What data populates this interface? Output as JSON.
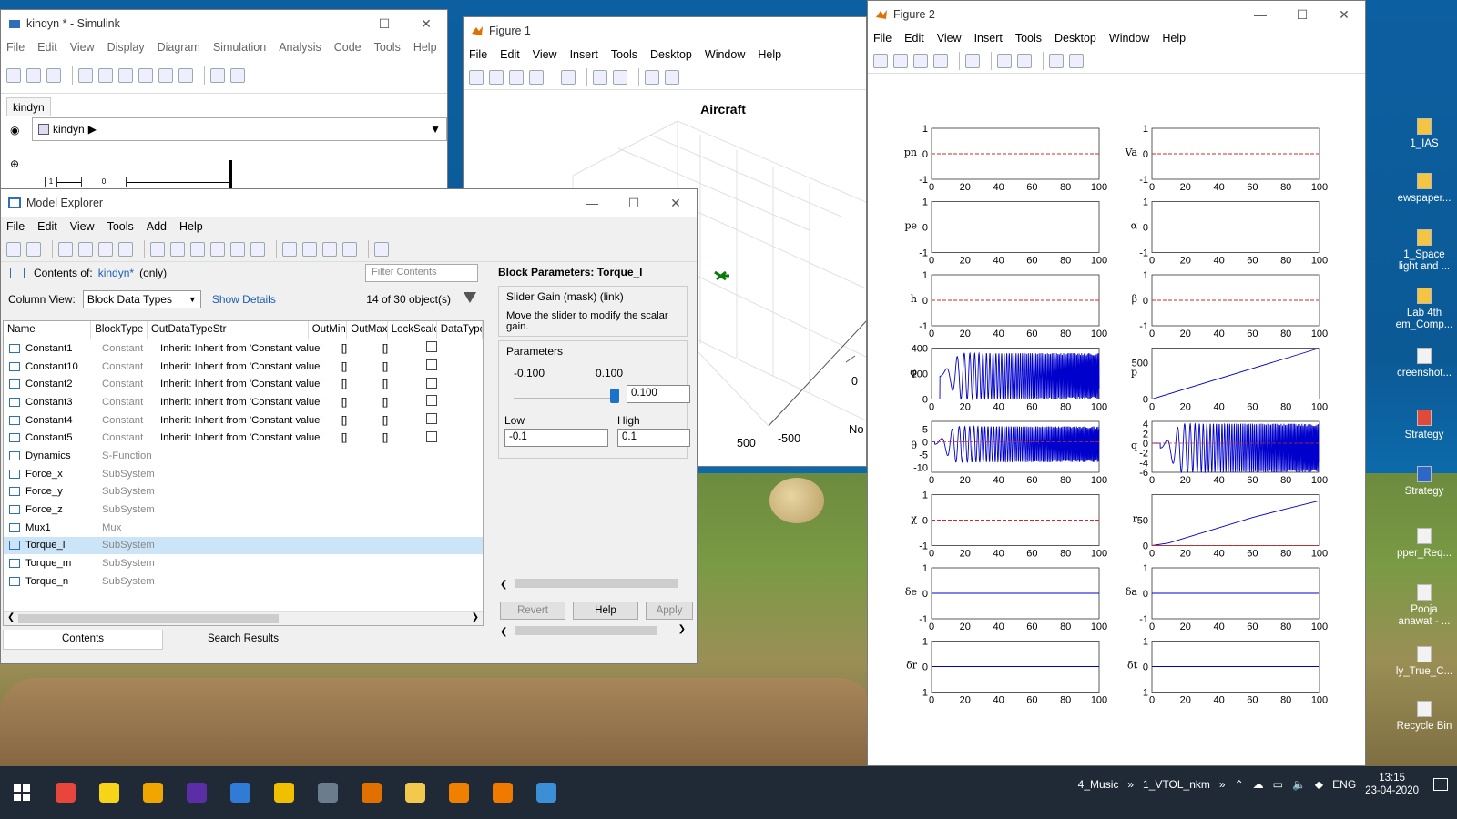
{
  "desktop": {
    "icons": [
      {
        "label": "1_IAS",
        "color": "y"
      },
      {
        "label": "ewspaper...",
        "color": "y"
      },
      {
        "label": "1_Space\nlight and ...",
        "color": "y"
      },
      {
        "label": "Lab 4th\nem_Comp...",
        "color": "y"
      },
      {
        "label": "creenshot...",
        "color": "w"
      },
      {
        "label": "Strategy",
        "color": "r"
      },
      {
        "label": "Strategy",
        "color": "b"
      },
      {
        "label": "pper_Req...",
        "color": "w"
      },
      {
        "label": "Pooja\nanawat - ...",
        "color": "o"
      },
      {
        "label": "ly_True_C...",
        "color": "w"
      },
      {
        "label": "Recycle Bin",
        "color": "w"
      }
    ]
  },
  "simulink": {
    "title": "kindyn * - Simulink",
    "menu": [
      "File",
      "Edit",
      "View",
      "Display",
      "Diagram",
      "Simulation",
      "Analysis",
      "Code",
      "Tools",
      "Help"
    ],
    "tab": "kindyn",
    "address": "kindyn",
    "block_labels": [
      "1",
      "0"
    ]
  },
  "figure1": {
    "title": "Figure 1",
    "menu": [
      "File",
      "Edit",
      "View",
      "Insert",
      "Tools",
      "Desktop",
      "Window",
      "Help"
    ],
    "plot_title": "Aircraft",
    "tick_labels": [
      "0",
      "500",
      "-500"
    ],
    "axis_label_partial": "No"
  },
  "figure2": {
    "title": "Figure 2",
    "menu": [
      "File",
      "Edit",
      "View",
      "Insert",
      "Tools",
      "Desktop",
      "Window",
      "Help"
    ],
    "x_ticks": [
      "0",
      "20",
      "40",
      "60",
      "80",
      "100"
    ]
  },
  "chart_data": [
    {
      "type": "line",
      "ylabel": "pn",
      "xlim": [
        0,
        100
      ],
      "ylim": [
        -1,
        1
      ],
      "yticks": [
        "1",
        "0",
        "-1"
      ],
      "series": [
        {
          "values": [
            [
              0,
              0
            ],
            [
              100,
              0
            ]
          ],
          "color": "#d62728",
          "dashed": true
        }
      ]
    },
    {
      "type": "line",
      "ylabel": "Va",
      "xlim": [
        0,
        100
      ],
      "ylim": [
        -1,
        1
      ],
      "yticks": [
        "1",
        "0",
        "-1"
      ],
      "series": [
        {
          "values": [
            [
              0,
              0
            ],
            [
              100,
              0
            ]
          ],
          "color": "#d62728",
          "dashed": true
        }
      ]
    },
    {
      "type": "line",
      "ylabel": "pe",
      "xlim": [
        0,
        100
      ],
      "ylim": [
        -1,
        1
      ],
      "yticks": [
        "1",
        "0",
        "-1"
      ],
      "series": [
        {
          "values": [
            [
              0,
              0
            ],
            [
              100,
              0
            ]
          ],
          "color": "#d62728",
          "dashed": true
        }
      ]
    },
    {
      "type": "line",
      "ylabel": "α",
      "xlim": [
        0,
        100
      ],
      "ylim": [
        -1,
        1
      ],
      "yticks": [
        "1",
        "0",
        "-1"
      ],
      "series": [
        {
          "values": [
            [
              0,
              0
            ],
            [
              100,
              0
            ]
          ],
          "color": "#d62728",
          "dashed": true
        }
      ]
    },
    {
      "type": "line",
      "ylabel": "h",
      "xlim": [
        0,
        100
      ],
      "ylim": [
        -1,
        1
      ],
      "yticks": [
        "1",
        "0",
        "-1"
      ],
      "series": [
        {
          "values": [
            [
              0,
              0
            ],
            [
              100,
              0
            ]
          ],
          "color": "#d62728",
          "dashed": true
        }
      ]
    },
    {
      "type": "line",
      "ylabel": "β",
      "xlim": [
        0,
        100
      ],
      "ylim": [
        -1,
        1
      ],
      "yticks": [
        "1",
        "0",
        "-1"
      ],
      "series": [
        {
          "values": [
            [
              0,
              0
            ],
            [
              100,
              0
            ]
          ],
          "color": "#d62728",
          "dashed": true
        }
      ]
    },
    {
      "type": "line",
      "ylabel": "φ",
      "xlim": [
        0,
        100
      ],
      "ylim": [
        0,
        400
      ],
      "yticks": [
        "400",
        "200",
        "0"
      ],
      "series": [
        {
          "kind": "oscillation",
          "amplitude": [
            0,
            360
          ],
          "start": 5,
          "color": "#0000cc"
        }
      ]
    },
    {
      "type": "line",
      "ylabel": "p",
      "xlim": [
        0,
        100
      ],
      "ylim": [
        0,
        700
      ],
      "yticks": [
        "500",
        "0"
      ],
      "series": [
        {
          "values": [
            [
              0,
              0
            ],
            [
              100,
              700
            ]
          ],
          "color": "#0000cc"
        },
        {
          "values": [
            [
              0,
              0
            ],
            [
              100,
              0
            ]
          ],
          "color": "#d62728",
          "dashed": true
        }
      ]
    },
    {
      "type": "line",
      "ylabel": "θ",
      "xlim": [
        0,
        100
      ],
      "ylim": [
        -12,
        8
      ],
      "yticks": [
        "5",
        "0",
        "-5",
        "-10"
      ],
      "series": [
        {
          "kind": "oscillation",
          "amplitude": [
            -8,
            6
          ],
          "start": 2,
          "color": "#0000cc"
        }
      ]
    },
    {
      "type": "line",
      "ylabel": "q",
      "xlim": [
        0,
        100
      ],
      "ylim": [
        -6,
        4.5
      ],
      "yticks": [
        "4",
        "2",
        "0",
        "-2",
        "-4",
        "-6"
      ],
      "series": [
        {
          "kind": "oscillation",
          "amplitude": [
            -6,
            4
          ],
          "start": 5,
          "color": "#0000cc"
        }
      ]
    },
    {
      "type": "line",
      "ylabel": "χ",
      "xlim": [
        0,
        100
      ],
      "ylim": [
        -1,
        1
      ],
      "yticks": [
        "1",
        "0",
        "-1"
      ],
      "series": [
        {
          "values": [
            [
              0,
              0
            ],
            [
              100,
              0
            ]
          ],
          "color": "#d62728",
          "dashed": true
        }
      ]
    },
    {
      "type": "line",
      "ylabel": "r",
      "xlim": [
        0,
        100
      ],
      "ylim": [
        0,
        100
      ],
      "yticks": [
        "50",
        "0"
      ],
      "series": [
        {
          "values": [
            [
              0,
              0
            ],
            [
              10,
              5
            ],
            [
              20,
              15
            ],
            [
              40,
              35
            ],
            [
              60,
              55
            ],
            [
              80,
              72
            ],
            [
              100,
              88
            ]
          ],
          "color": "#0000cc"
        },
        {
          "values": [
            [
              0,
              0
            ],
            [
              100,
              0
            ]
          ],
          "color": "#d62728",
          "dashed": true
        }
      ]
    },
    {
      "type": "line",
      "ylabel": "δe",
      "xlim": [
        0,
        100
      ],
      "ylim": [
        -1,
        1
      ],
      "yticks": [
        "1",
        "0",
        "-1"
      ],
      "series": [
        {
          "values": [
            [
              0,
              0
            ],
            [
              100,
              0
            ]
          ],
          "color": "#0000cc"
        }
      ]
    },
    {
      "type": "line",
      "ylabel": "δa",
      "xlim": [
        0,
        100
      ],
      "ylim": [
        -1,
        1
      ],
      "yticks": [
        "1",
        "0",
        "-1"
      ],
      "series": [
        {
          "values": [
            [
              0,
              0
            ],
            [
              100,
              0
            ]
          ],
          "color": "#0000cc"
        }
      ]
    },
    {
      "type": "line",
      "ylabel": "δr",
      "xlim": [
        0,
        100
      ],
      "ylim": [
        -1,
        1
      ],
      "yticks": [
        "1",
        "0",
        "-1"
      ],
      "series": [
        {
          "values": [
            [
              0,
              0
            ],
            [
              100,
              0
            ]
          ],
          "color": "#0000cc"
        }
      ]
    },
    {
      "type": "line",
      "ylabel": "δt",
      "xlim": [
        0,
        100
      ],
      "ylim": [
        -1,
        1
      ],
      "yticks": [
        "1",
        "0",
        "-1"
      ],
      "series": [
        {
          "values": [
            [
              0,
              0
            ],
            [
              100,
              0
            ]
          ],
          "color": "#0000cc"
        }
      ]
    }
  ],
  "model_explorer": {
    "title": "Model Explorer",
    "menu": [
      "File",
      "Edit",
      "View",
      "Tools",
      "Add",
      "Help"
    ],
    "contents_of_label": "Contents of:",
    "contents_of_model": "kindyn*",
    "contents_of_suffix": "(only)",
    "filter_placeholder": "Filter Contents",
    "column_view_label": "Column View:",
    "column_view_value": "Block Data Types",
    "show_details": "Show Details",
    "object_count": "14 of 30 object(s)",
    "columns": [
      "Name",
      "BlockType",
      "OutDataTypeStr",
      "OutMin",
      "OutMax",
      "LockScale",
      "DataType"
    ],
    "rows": [
      {
        "name": "Constant1",
        "type": "Constant",
        "out": "Inherit: Inherit from 'Constant value'",
        "min": "[]",
        "max": "[]",
        "lock": true
      },
      {
        "name": "Constant10",
        "type": "Constant",
        "out": "Inherit: Inherit from 'Constant value'",
        "min": "[]",
        "max": "[]",
        "lock": true
      },
      {
        "name": "Constant2",
        "type": "Constant",
        "out": "Inherit: Inherit from 'Constant value'",
        "min": "[]",
        "max": "[]",
        "lock": true
      },
      {
        "name": "Constant3",
        "type": "Constant",
        "out": "Inherit: Inherit from 'Constant value'",
        "min": "[]",
        "max": "[]",
        "lock": true
      },
      {
        "name": "Constant4",
        "type": "Constant",
        "out": "Inherit: Inherit from 'Constant value'",
        "min": "[]",
        "max": "[]",
        "lock": true
      },
      {
        "name": "Constant5",
        "type": "Constant",
        "out": "Inherit: Inherit from 'Constant value'",
        "min": "[]",
        "max": "[]",
        "lock": true
      },
      {
        "name": "Dynamics",
        "type": "S-Function",
        "out": "",
        "min": "",
        "max": "",
        "lock": false
      },
      {
        "name": "Force_x",
        "type": "SubSystem",
        "out": "",
        "min": "",
        "max": "",
        "lock": false
      },
      {
        "name": "Force_y",
        "type": "SubSystem",
        "out": "",
        "min": "",
        "max": "",
        "lock": false
      },
      {
        "name": "Force_z",
        "type": "SubSystem",
        "out": "",
        "min": "",
        "max": "",
        "lock": false
      },
      {
        "name": "Mux1",
        "type": "Mux",
        "out": "",
        "min": "",
        "max": "",
        "lock": false
      },
      {
        "name": "Torque_l",
        "type": "SubSystem",
        "out": "",
        "min": "",
        "max": "",
        "lock": false,
        "selected": true
      },
      {
        "name": "Torque_m",
        "type": "SubSystem",
        "out": "",
        "min": "",
        "max": "",
        "lock": false
      },
      {
        "name": "Torque_n",
        "type": "SubSystem",
        "out": "",
        "min": "",
        "max": "",
        "lock": false
      }
    ],
    "bottom_tabs": [
      "Contents",
      "Search Results"
    ],
    "block_params": {
      "title": "Block Parameters: Torque_l",
      "mask": "Slider Gain (mask) (link)",
      "description": "Move the slider to modify the scalar gain.",
      "params_label": "Parameters",
      "slider_min_label": "-0.100",
      "slider_max_label": "0.100",
      "slider_value": "0.100",
      "slider_fraction": 1.0,
      "low_label": "Low",
      "high_label": "High",
      "low_value": "-0.1",
      "high_value": "0.1",
      "revert": "Revert",
      "help": "Help",
      "apply": "Apply"
    }
  },
  "taskbar": {
    "apps": [
      {
        "name": "chrome",
        "color": "#e8453c"
      },
      {
        "name": "sticky-notes",
        "color": "#f7d417"
      },
      {
        "name": "pen-app",
        "color": "#f0a500"
      },
      {
        "name": "music",
        "color": "#5b2ea6"
      },
      {
        "name": "notepad",
        "color": "#2f7bd6"
      },
      {
        "name": "bulb",
        "color": "#f0c000"
      },
      {
        "name": "explorer-app",
        "color": "#6b7c8c"
      },
      {
        "name": "matlab",
        "color": "#e07000"
      },
      {
        "name": "files",
        "color": "#f2c94c"
      },
      {
        "name": "vlc",
        "color": "#f08000"
      },
      {
        "name": "sublime",
        "color": "#f07a00"
      },
      {
        "name": "paint",
        "color": "#3a8fd6"
      }
    ],
    "folders": [
      "4_Music",
      "1_VTOL_nkm"
    ],
    "language": "ENG",
    "time": "13:15",
    "date": "23-04-2020"
  }
}
